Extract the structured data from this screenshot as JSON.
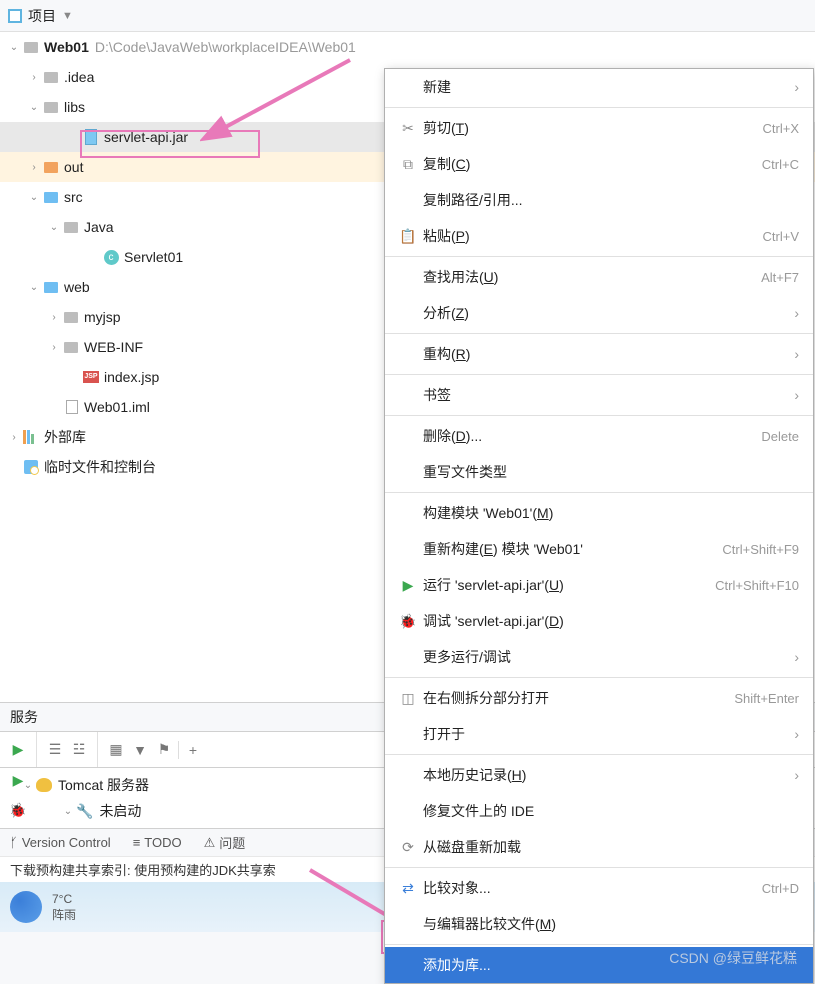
{
  "topbar": {
    "title": "项目"
  },
  "tree": {
    "root": {
      "name": "Web01",
      "path": "D:\\Code\\JavaWeb\\workplaceIDEA\\Web01"
    },
    "idea": ".idea",
    "libs": "libs",
    "servlet_jar": "servlet-api.jar",
    "out": "out",
    "src": "src",
    "java": "Java",
    "servlet01": "Servlet01",
    "web": "web",
    "myjsp": "myjsp",
    "webinf": "WEB-INF",
    "indexjsp": "index.jsp",
    "iml": "Web01.iml",
    "extlib": "外部库",
    "scratch": "临时文件和控制台"
  },
  "services": {
    "title": "服务",
    "tomcat": "Tomcat 服务器",
    "not_started": "未启动"
  },
  "bottombar": {
    "vcs": "Version Control",
    "todo": "TODO",
    "problems": "问题"
  },
  "statusline": "下载预构建共享索引: 使用预构建的JDK共享索",
  "weather": {
    "temp": "7°C",
    "desc": "阵雨"
  },
  "menu": {
    "new": "新建",
    "cut": "剪切",
    "cut_u": "T",
    "cut_sc": "Ctrl+X",
    "copy": "复制",
    "copy_u": "C",
    "copy_sc": "Ctrl+C",
    "copypath": "复制路径/引用...",
    "paste": "粘贴",
    "paste_u": "P",
    "paste_sc": "Ctrl+V",
    "findusage": "查找用法",
    "findusage_u": "U",
    "findusage_sc": "Alt+F7",
    "analyze": "分析",
    "analyze_u": "Z",
    "refactor": "重构",
    "refactor_u": "R",
    "bookmark": "书签",
    "delete": "删除",
    "delete_u": "D",
    "delete_sc": "Delete",
    "override": "重写文件类型",
    "buildmodule": "构建模块 'Web01'",
    "buildmodule_u": "M",
    "rebuild_pre": "重新构建",
    "rebuild_u": "E",
    "rebuild_post": " 模块 'Web01'",
    "rebuild_sc": "Ctrl+Shift+F9",
    "run": "运行 'servlet-api.jar'",
    "run_u": "U",
    "run_sc": "Ctrl+Shift+F10",
    "debug": "调试 'servlet-api.jar'",
    "debug_u": "D",
    "morerun": "更多运行/调试",
    "splitright": "在右侧拆分部分打开",
    "splitright_sc": "Shift+Enter",
    "openin": "打开于",
    "localhistory": "本地历史记录",
    "localhistory_u": "H",
    "repairide": "修复文件上的 IDE",
    "reload": "从磁盘重新加载",
    "compare": "比较对象...",
    "compare_sc": "Ctrl+D",
    "compareeditor": "与编辑器比较文件",
    "compareeditor_u": "M",
    "addaslib": "添加为库..."
  },
  "watermark": "CSDN @绿豆鲜花糕"
}
